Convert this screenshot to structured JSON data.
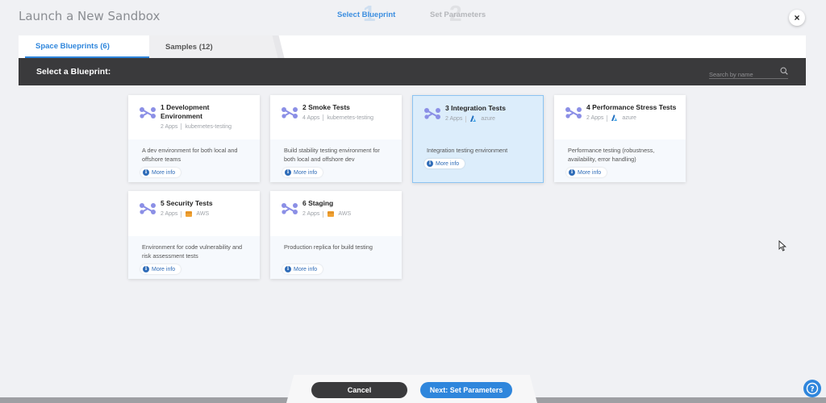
{
  "window": {
    "title": "Launch a New Sandbox",
    "close_label": "×"
  },
  "stepper": {
    "steps": [
      {
        "number": "1",
        "label": "Select Blueprint",
        "active": true
      },
      {
        "number": "2",
        "label": "Set Parameters",
        "active": false
      }
    ]
  },
  "tabs": [
    {
      "label": "Space Blueprints (6)",
      "active": true
    },
    {
      "label": "Samples (12)",
      "active": false
    }
  ],
  "header": {
    "title": "Select a Blueprint:",
    "search_placeholder": "Search by name"
  },
  "more_info_label": "More info",
  "cards": [
    {
      "title": "1 Development Environment",
      "apps": "2 Apps",
      "provider": "kubernetes-testing",
      "provider_icon": "none",
      "description": "A dev environment for both local and offshore teams",
      "selected": false
    },
    {
      "title": "2 Smoke Tests",
      "apps": "4 Apps",
      "provider": "kubernetes-testing",
      "provider_icon": "none",
      "description": "Build stability testing environment for both local and offshore dev",
      "selected": false
    },
    {
      "title": "3 Integration Tests",
      "apps": "2 Apps",
      "provider": "azure",
      "provider_icon": "azure-icon",
      "description": "Integration testing environment",
      "selected": true
    },
    {
      "title": "4 Performance Stress Tests",
      "apps": "2 Apps",
      "provider": "azure",
      "provider_icon": "azure-icon",
      "description": "Performance testing (robustness, availability, error handling)",
      "selected": false
    },
    {
      "title": "5 Security Tests",
      "apps": "2 Apps",
      "provider": "AWS",
      "provider_icon": "aws-icon",
      "description": "Environment for code vulnerability and risk assessment tests",
      "selected": false
    },
    {
      "title": "6 Staging",
      "apps": "2 Apps",
      "provider": "AWS",
      "provider_icon": "aws-icon",
      "description": "Production replica for build testing",
      "selected": false
    }
  ],
  "footer": {
    "cancel_label": "Cancel",
    "next_label": "Next: Set Parameters"
  },
  "colors": {
    "accent": "#2f86dc",
    "dark": "#3a3a3c",
    "selected_bg": "#dcedfb",
    "aws": "#f0a233",
    "azure": "#1f6fc0"
  }
}
